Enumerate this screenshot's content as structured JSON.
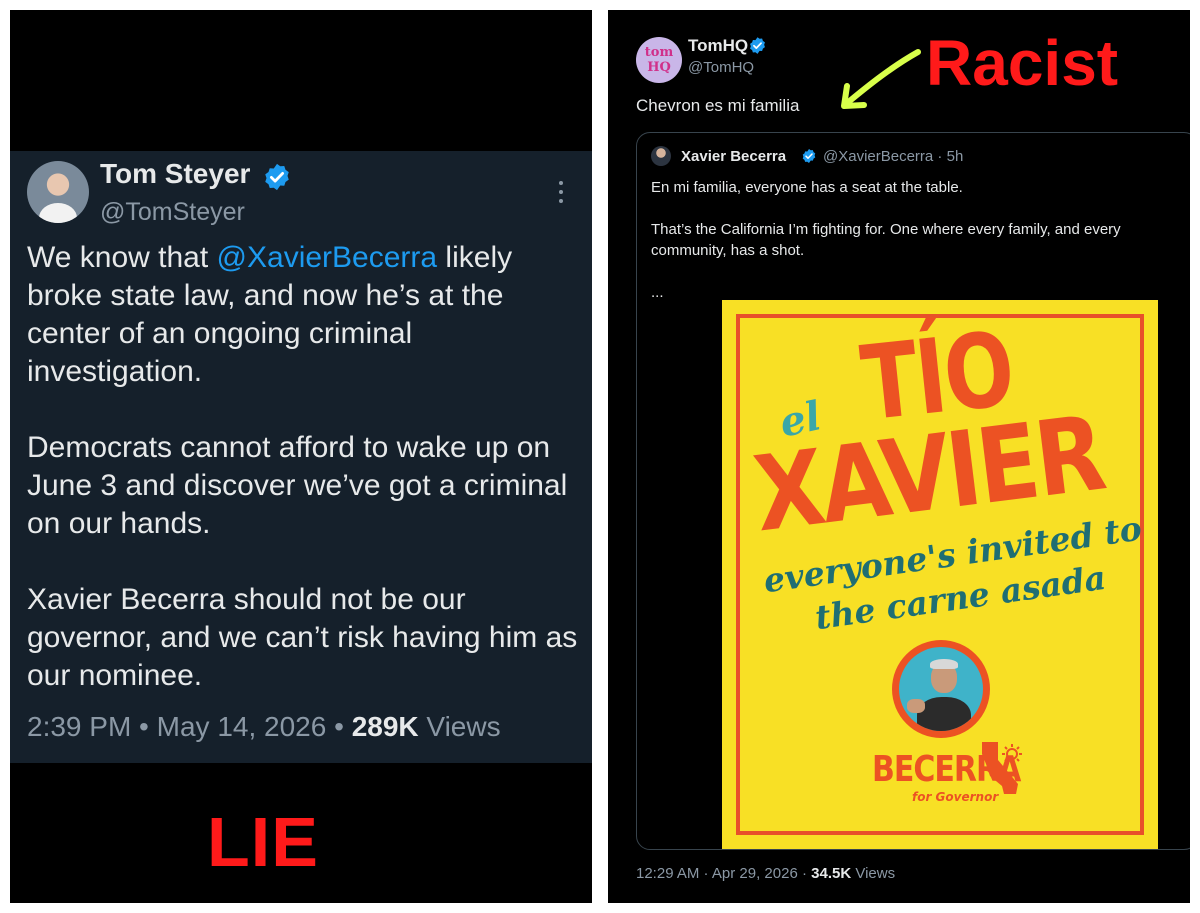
{
  "left_tweet": {
    "name": "Tom Steyer",
    "handle": "@TomSteyer",
    "body": {
      "p1_before": "We know that ",
      "p1_mention": "@XavierBecerra",
      "p1_after": " likely broke state law, and now he’s at the center of an ongoing criminal investigation.",
      "p2": "Democrats cannot afford to wake up on June 3 and discover we’ve got a criminal on our hands.",
      "p3": "Xavier Becerra should not be our governor, and we can’t risk having him as our nominee."
    },
    "time": "2:39 PM",
    "sep": " • ",
    "date": "May 14, 2026",
    "views_count": "289K",
    "views_label": " Views"
  },
  "left_label": "LIE",
  "right_tweet": {
    "avatar_text_1": "tom",
    "avatar_text_2": "HQ",
    "name": "TomHQ",
    "handle": "@TomHQ",
    "text": "Chevron es mi familia",
    "quoted": {
      "name": "Xavier Becerra",
      "handle": "@XavierBecerra · 5h",
      "p1": "En mi familia, everyone has a seat at the table.",
      "p2": "That’s the California I’m fighting for. One where every family, and every community, has a shot.",
      "ellipsis": "...",
      "poster": {
        "el": "el",
        "tio": "TÍO",
        "xavier": "XAVIER",
        "tagline_1": "everyone's invited to",
        "tagline_2": "the carne asada",
        "becerra": "BECERRA",
        "for_governor": "for Governor"
      }
    },
    "time": "12:29 AM",
    "sep": " · ",
    "date": "Apr 29, 2026",
    "sep2": " · ",
    "views_count": "34.5K",
    "views_label": " Views"
  },
  "right_label": "Racist",
  "colors": {
    "label_red": "#ff1a1a",
    "arrow_green": "#d8ff4a",
    "verified_blue": "#1d9bf0",
    "poster_yellow": "#f8e025",
    "poster_orange": "#ec5223",
    "poster_teal": "#1f6e73"
  },
  "icons": [
    "verified-badge-icon",
    "more-options-icon",
    "arrow-icon",
    "california-icon"
  ]
}
